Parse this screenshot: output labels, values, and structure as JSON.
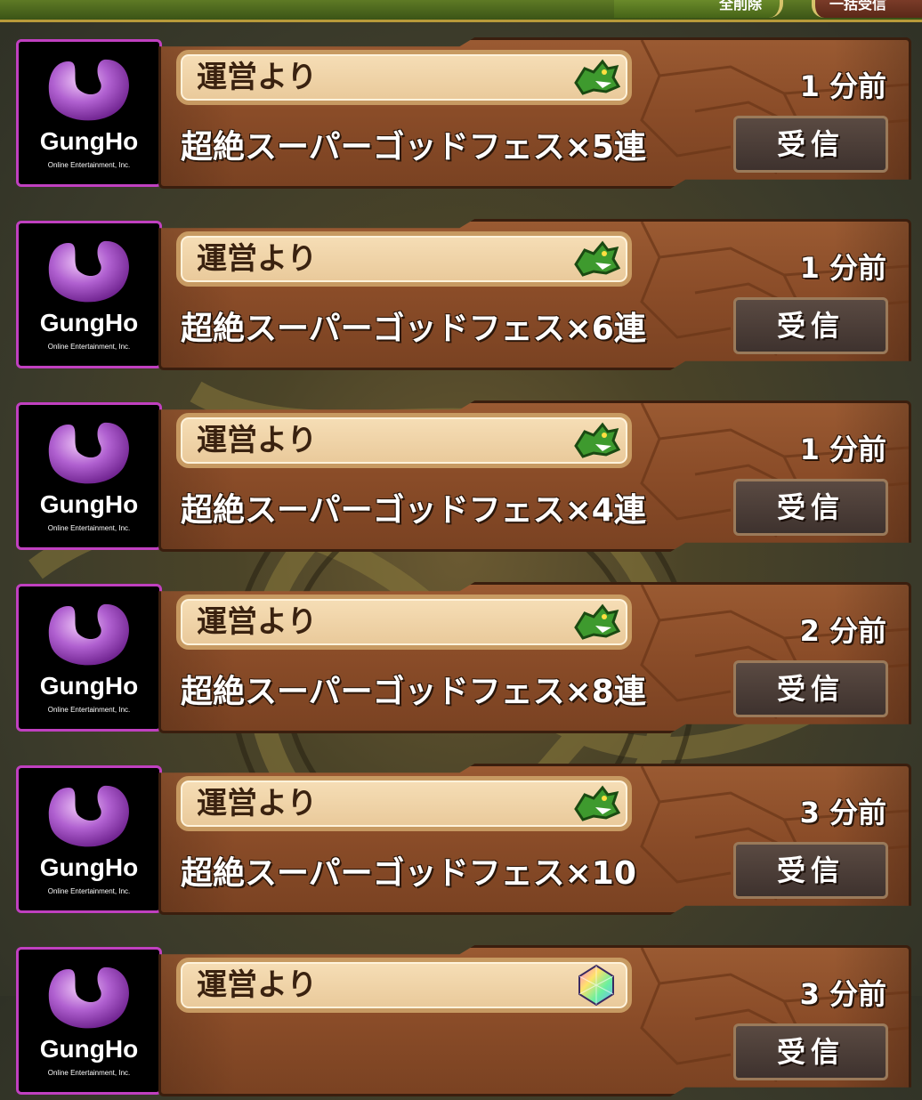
{
  "top_bar": {
    "left_tab_label": "全削除",
    "right_tab_label": "一括受信"
  },
  "colors": {
    "avatar_border": "#c040c0",
    "plate": "#8a4c28",
    "label_box": "#f0d4a8",
    "button": "#4a3c36"
  },
  "mails": [
    {
      "sender": "運営より",
      "subject": "超絶スーパーゴッドフェス×5連",
      "time": "1 分前",
      "button": "受信",
      "gift_icon": "dragon-icon"
    },
    {
      "sender": "運営より",
      "subject": "超絶スーパーゴッドフェス×6連",
      "time": "1 分前",
      "button": "受信",
      "gift_icon": "dragon-icon"
    },
    {
      "sender": "運営より",
      "subject": "超絶スーパーゴッドフェス×4連",
      "time": "1 分前",
      "button": "受信",
      "gift_icon": "dragon-icon"
    },
    {
      "sender": "運営より",
      "subject": "超絶スーパーゴッドフェス×8連",
      "time": "2 分前",
      "button": "受信",
      "gift_icon": "dragon-icon"
    },
    {
      "sender": "運営より",
      "subject": "超絶スーパーゴッドフェス×10",
      "time": "3 分前",
      "button": "受信",
      "gift_icon": "dragon-icon"
    },
    {
      "sender": "運営より",
      "subject": "",
      "time": "3 分前",
      "button": "受信",
      "gift_icon": "magic-stone-icon"
    }
  ],
  "logo": {
    "word": "GungHo",
    "sub": "Online Entertainment, Inc."
  }
}
